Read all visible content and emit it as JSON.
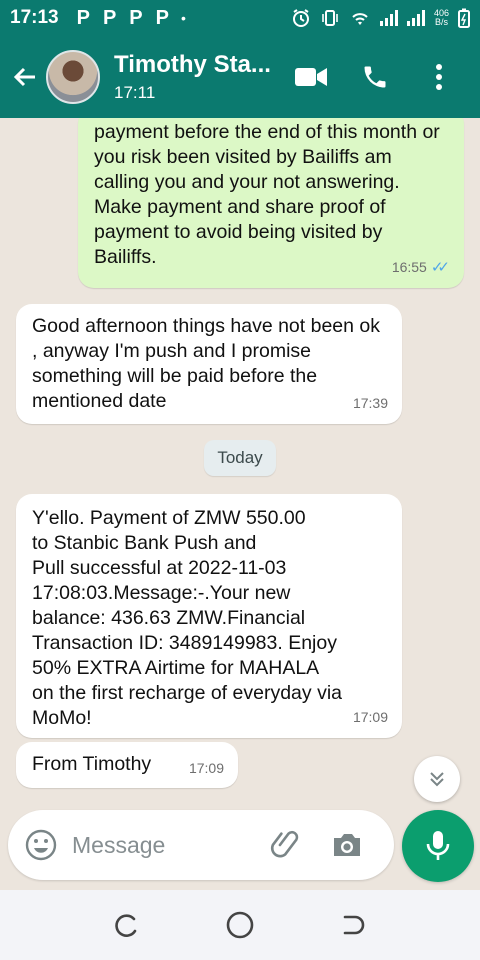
{
  "status_bar": {
    "time": "17:13",
    "notification_icons": [
      "P",
      "P",
      "P",
      "P"
    ],
    "dot": "•",
    "netspeed_top": "406",
    "netspeed_bottom": "B/s"
  },
  "header": {
    "contact_name": "Timothy Sta...",
    "subtitle": "17:11",
    "icons": [
      "back-arrow-icon",
      "video-call-icon",
      "voice-call-icon",
      "more-options-icon"
    ]
  },
  "messages": [
    {
      "direction": "out",
      "text": "payment before the end of this month or you risk been visited by Bailiffs am calling you and your not answering. Make payment and share proof of payment to avoid being visited by Bailiffs.",
      "time": "16:55",
      "read": true
    },
    {
      "direction": "in",
      "text": "Good afternoon things have not been ok , anyway I'm push and I promise something will be paid before the mentioned date",
      "time": "17:39"
    },
    {
      "direction": "in",
      "text": "Y'ello. Payment of ZMW 550.00\nto Stanbic Bank Push and\nPull  successful at 2022-11-03\n17:08:03.Message:-.Your new\nbalance: 436.63 ZMW.Financial\nTransaction ID: 3489149983. Enjoy\n50% EXTRA Airtime for MAHALA\non the first recharge of everyday via\nMoMo!",
      "time": "17:09"
    },
    {
      "direction": "in",
      "text": "From Timothy",
      "time": "17:09"
    }
  ],
  "date_divider": "Today",
  "composer": {
    "placeholder": "Message"
  },
  "colors": {
    "header": "#0b7a6f",
    "outgoing_bubble": "#dcf8c6",
    "incoming_bubble": "#ffffff",
    "chat_background": "#ece5dd",
    "mic_button": "#0b9e6e",
    "read_ticks": "#4fa6e8"
  }
}
